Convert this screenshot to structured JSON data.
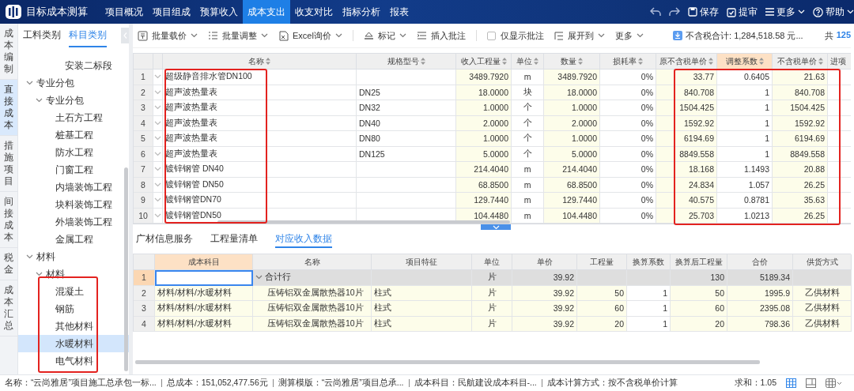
{
  "app": {
    "title": "目标成本测算",
    "nav": [
      {
        "label": "项目概况",
        "selected": false
      },
      {
        "label": "项目组成",
        "selected": false
      },
      {
        "label": "预算收入",
        "selected": false
      },
      {
        "label": "成本支出",
        "selected": true
      },
      {
        "label": "收支对比",
        "selected": false
      },
      {
        "label": "指标分析",
        "selected": false
      },
      {
        "label": "报表",
        "selected": false
      }
    ],
    "actions": [
      {
        "kind": "undo"
      },
      {
        "kind": "redo"
      },
      {
        "kind": "save",
        "label": "保存"
      },
      {
        "kind": "review",
        "label": "提审"
      },
      {
        "kind": "more",
        "label": "更多"
      },
      {
        "kind": "help",
        "label": "帮助"
      }
    ]
  },
  "side_tabs": [
    {
      "label": "成本编制",
      "selected": false
    },
    {
      "label": "直接成本",
      "selected": true
    },
    {
      "label": "措施项目",
      "selected": false
    },
    {
      "label": "间接成本",
      "selected": false
    },
    {
      "label": "税金",
      "selected": false
    },
    {
      "label": "成本汇总",
      "selected": false
    }
  ],
  "tree": {
    "tabs": [
      {
        "label": "工料类别",
        "selected": false
      },
      {
        "label": "科目类别",
        "selected": true
      }
    ],
    "items": [
      {
        "label": "安装二标段",
        "selected": false
      },
      {
        "label": "专业分包",
        "selected": false,
        "expanded": true,
        "children": [
          {
            "label": "专业分包",
            "selected": false,
            "expanded": true,
            "children": [
              {
                "label": "土石方工程",
                "selected": false
              },
              {
                "label": "桩基工程",
                "selected": false
              },
              {
                "label": "防水工程",
                "selected": false
              },
              {
                "label": "门窗工程",
                "selected": false
              },
              {
                "label": "内墙装饰工程",
                "selected": false
              },
              {
                "label": "块料装饰工程",
                "selected": false
              },
              {
                "label": "外墙装饰工程",
                "selected": false
              },
              {
                "label": "金属工程",
                "selected": false
              }
            ]
          }
        ]
      },
      {
        "label": "材料",
        "selected": false,
        "expanded": true,
        "children": [
          {
            "label": "材料",
            "selected": false,
            "expanded": true,
            "children": [
              {
                "label": "混凝土",
                "selected": false
              },
              {
                "label": "钢筋",
                "selected": false
              },
              {
                "label": "其他材料",
                "selected": false
              },
              {
                "label": "水暖材料",
                "selected": true
              },
              {
                "label": "电气材料",
                "selected": false
              }
            ]
          }
        ]
      }
    ]
  },
  "toolbar": {
    "items": [
      {
        "kind": "menu",
        "label": "批量载价"
      },
      {
        "kind": "menu",
        "label": "批量调整"
      },
      {
        "kind": "menu",
        "label": "Excel询价"
      },
      {
        "kind": "separator"
      },
      {
        "kind": "menu",
        "label": "标记"
      },
      {
        "kind": "button",
        "label": "插入批注"
      },
      {
        "kind": "separator"
      },
      {
        "kind": "checkbox",
        "label": "仅显示批注",
        "checked": false
      },
      {
        "kind": "menu",
        "label": "展开到"
      },
      {
        "kind": "menu",
        "label": "更多"
      }
    ],
    "summary": "不含税合计: 1,284,518.58 元...",
    "count_label": "共",
    "count": "125"
  },
  "upper_grid": {
    "expandable": true,
    "columns": [
      {
        "kind": "text",
        "label": "名称",
        "sortable": true,
        "editable": false,
        "active": false
      },
      {
        "kind": "text",
        "label": "规格型号",
        "sortable": true,
        "editable": false,
        "active": false
      },
      {
        "kind": "number",
        "label": "收入工程量",
        "sortable": true,
        "editable": true,
        "active": false
      },
      {
        "kind": "center",
        "label": "单位",
        "sortable": true,
        "editable": false,
        "active": false
      },
      {
        "kind": "number",
        "label": "数量",
        "sortable": true,
        "editable": true,
        "active": false
      },
      {
        "kind": "number",
        "label": "损耗率",
        "sortable": true,
        "editable": false,
        "active": false
      },
      {
        "kind": "number",
        "label": "原不含税单价",
        "sortable": true,
        "editable": true,
        "active": false
      },
      {
        "kind": "number",
        "label": "调整系数",
        "sortable": true,
        "editable": false,
        "active": true
      },
      {
        "kind": "number",
        "label": "不含税单价",
        "sortable": true,
        "editable": true,
        "active": false
      },
      {
        "kind": "text",
        "label": "进项",
        "sortable": false,
        "editable": false,
        "active": false
      }
    ],
    "rows": [
      {
        "index": "1",
        "cells": [
          "超级静音排水管DN100",
          null,
          "3489.7920",
          "m",
          "3489.7920",
          "0%",
          "33.77",
          "0.6405",
          "21.63"
        ]
      },
      {
        "index": "2",
        "cells": [
          "超声波热量表",
          "DN25",
          "18.0000",
          "块",
          "18.0000",
          "0%",
          "840.708",
          "1",
          "840.708"
        ]
      },
      {
        "index": "3",
        "cells": [
          "超声波热量表",
          "DN32",
          "1.0000",
          "个",
          "1.0000",
          "0%",
          "1504.425",
          "1",
          "1504.425"
        ]
      },
      {
        "index": "4",
        "cells": [
          "超声波热量表",
          "DN40",
          "2.0000",
          "个",
          "2.0000",
          "0%",
          "1592.92",
          "1",
          "1592.92"
        ]
      },
      {
        "index": "5",
        "cells": [
          "超声波热量表",
          "DN80",
          "1.0000",
          "个",
          "1.0000",
          "0%",
          "6194.69",
          "1",
          "6194.69"
        ]
      },
      {
        "index": "6",
        "cells": [
          "超声波热量表",
          "DN125",
          "5.0000",
          "个",
          "5.0000",
          "0%",
          "8849.558",
          "1",
          "8849.558"
        ]
      },
      {
        "index": "7",
        "cells": [
          "镀锌钢管 DN40",
          null,
          "214.4040",
          "m",
          "214.4040",
          "0%",
          "18.168",
          "1.1493",
          "20.88"
        ]
      },
      {
        "index": "8",
        "cells": [
          "镀锌钢管 DN50",
          null,
          "68.8500",
          "m",
          "68.8500",
          "0%",
          "24.834",
          "1.057",
          "26.25"
        ]
      },
      {
        "index": "9",
        "cells": [
          "镀锌钢管DN70",
          null,
          "129.7440",
          "m",
          "129.7440",
          "0%",
          "40.575",
          "0.8781",
          "35.63"
        ]
      },
      {
        "index": "10",
        "cells": [
          "镀锌钢管DN50",
          null,
          "104.4480",
          "m",
          "104.4480",
          "0%",
          "25.703",
          "1.0213",
          "26.25"
        ]
      }
    ]
  },
  "lower_tabs": [
    {
      "label": "广材信息服务",
      "selected": false
    },
    {
      "label": "工程量清单",
      "selected": false
    },
    {
      "label": "对应收入数据",
      "selected": true
    }
  ],
  "lower_grid": {
    "columns": [
      {
        "kind": "text",
        "label": "成本科目",
        "editable": true,
        "active": true
      },
      {
        "kind": "tree",
        "label": "名称",
        "editable": true,
        "active": false
      },
      {
        "kind": "text",
        "label": "项目特征",
        "editable": true,
        "active": false
      },
      {
        "kind": "center",
        "label": "单位",
        "editable": true,
        "active": false
      },
      {
        "kind": "number",
        "label": "单价",
        "editable": true,
        "active": false
      },
      {
        "kind": "number",
        "label": "工程量",
        "editable": true,
        "active": false
      },
      {
        "kind": "number",
        "label": "换算系数",
        "editable": false,
        "active": false
      },
      {
        "kind": "number",
        "label": "换算后工程量",
        "editable": true,
        "active": false
      },
      {
        "kind": "number",
        "label": "合价",
        "editable": true,
        "active": false
      },
      {
        "kind": "center",
        "label": "供货方式",
        "editable": true,
        "active": false
      }
    ],
    "rows": [
      {
        "index": "1",
        "kind": "total",
        "selected": true,
        "cells": [
          null,
          "合计行",
          null,
          "片",
          "39.92",
          null,
          null,
          "130",
          "5189.34",
          null
        ]
      },
      {
        "index": "2",
        "kind": "item",
        "selected": false,
        "cells": [
          "材料/材料/水暖材料",
          "压铸铝双金属散热器10片",
          "柱式",
          "片",
          "39.92",
          "50",
          "1",
          "50",
          "1995.9",
          "乙供材料"
        ]
      },
      {
        "index": "3",
        "kind": "item",
        "selected": false,
        "cells": [
          "材料/材料/水暖材料",
          "压铸铝双金属散热器10片",
          "柱式",
          "片",
          "39.92",
          "60",
          "1",
          "60",
          "2395.08",
          "乙供材料"
        ]
      },
      {
        "index": "4",
        "kind": "item",
        "selected": false,
        "cells": [
          "材料/材料/水暖材料",
          "压铸铝双金属散热器10片",
          "柱式",
          "片",
          "39.92",
          "20",
          "1",
          "20",
          "798.36",
          "乙供材料"
        ]
      }
    ]
  },
  "status_bar": {
    "items": [
      "名称：“云尚雅居”项目施工总承包一标...",
      "总成本：151,052,477.56元",
      "测算模版：“云尚雅居”项目总承...",
      "成本科目：民航建设成本科目-...",
      "成本计算方式：按不含税单价计算"
    ],
    "sum": "求和：1.05",
    "views": [
      {
        "selected": true
      },
      {
        "selected": false
      },
      {
        "selected": false
      }
    ]
  },
  "highlights": [
    {
      "kind": "name-column"
    },
    {
      "kind": "price-columns"
    },
    {
      "kind": "material-items"
    }
  ]
}
